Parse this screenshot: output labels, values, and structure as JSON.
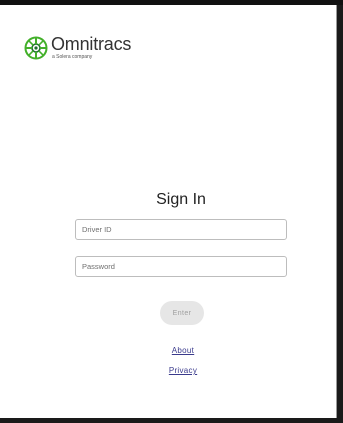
{
  "brand": {
    "name": "Omnitracs",
    "tagline": "a Solera company",
    "colors": {
      "logo_green": "#43b02a",
      "logo_dark": "#1f6e2e"
    },
    "logo_icon": "omnitracs-globe-icon"
  },
  "signin": {
    "title": "Sign In",
    "driver_id_placeholder": "Driver ID",
    "driver_id_value": "",
    "password_placeholder": "Password",
    "password_value": "",
    "enter_label": "Enter"
  },
  "links": {
    "about": "About",
    "privacy": "Privacy"
  },
  "colors": {
    "link": "#3a3a8c",
    "button_disabled_bg": "#e6e6e6",
    "button_disabled_text": "#9e9e9e"
  }
}
